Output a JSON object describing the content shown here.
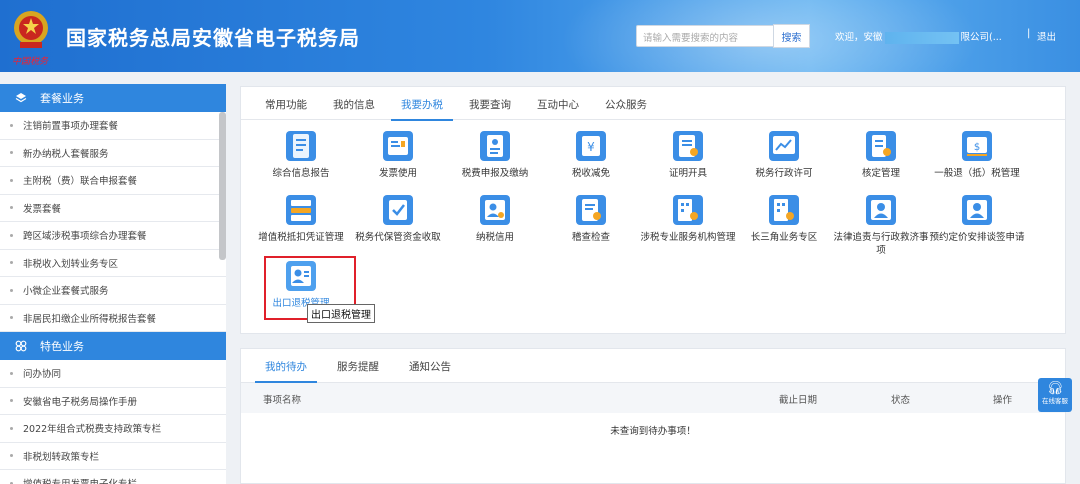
{
  "header": {
    "site_title": "国家税务总局安徽省电子税务局",
    "emblem_text": "中国税务",
    "search_placeholder": "请输入需要搜索的内容",
    "search_button": "搜索",
    "welcome_prefix": "欢迎，安徽",
    "welcome_suffix": "限公司(...",
    "separator": "|",
    "logout": "退出"
  },
  "sidebar": {
    "group1_title": "套餐业务",
    "group1_items": [
      "注销前置事项办理套餐",
      "新办纳税人套餐服务",
      "主附税（费）联合申报套餐",
      "发票套餐",
      "跨区域涉税事项综合办理套餐",
      "非税收入划转业务专区",
      "小微企业套餐式服务",
      "非居民扣缴企业所得税报告套餐"
    ],
    "group2_title": "特色业务",
    "group2_items": [
      "问办协同",
      "安徽省电子税务局操作手册",
      "2022年组合式税费支持政策专栏",
      "非税划转政策专栏",
      "增值税专用发票电子化专栏"
    ]
  },
  "main": {
    "tabs": [
      "常用功能",
      "我的信息",
      "我要办税",
      "我要查询",
      "互动中心",
      "公众服务"
    ],
    "active_tab": "我要办税",
    "tiles": [
      {
        "label": "综合信息报告",
        "icon": "report-icon"
      },
      {
        "label": "发票使用",
        "icon": "invoice-icon"
      },
      {
        "label": "税费申报及缴纳",
        "icon": "tax-declare-icon"
      },
      {
        "label": "税收减免",
        "icon": "tax-reduction-icon"
      },
      {
        "label": "证明开具",
        "icon": "certificate-icon"
      },
      {
        "label": "税务行政许可",
        "icon": "admin-license-icon"
      },
      {
        "label": "核定管理",
        "icon": "assessment-icon"
      },
      {
        "label": "一般退（抵）税管理",
        "icon": "refund-icon"
      },
      {
        "label": "增值税抵扣凭证管理",
        "icon": "vat-deduction-icon"
      },
      {
        "label": "税务代保管资金收取",
        "icon": "custody-fund-icon"
      },
      {
        "label": "纳税信用",
        "icon": "tax-credit-icon"
      },
      {
        "label": "稽查检查",
        "icon": "inspection-icon"
      },
      {
        "label": "涉税专业服务机构管理",
        "icon": "agency-icon"
      },
      {
        "label": "长三角业务专区",
        "icon": "yangtze-delta-icon"
      },
      {
        "label": "法律追责与行政救济事项",
        "icon": "legal-icon"
      },
      {
        "label": "预约定价安排谈签申请",
        "icon": "pricing-icon"
      },
      {
        "label": "出口退税管理",
        "icon": "export-refund-icon"
      }
    ],
    "tooltip": "出口退税管理"
  },
  "todo": {
    "tabs": [
      "我的待办",
      "服务提醒",
      "通知公告"
    ],
    "active_tab": "我的待办",
    "columns": [
      "事项名称",
      "截止日期",
      "状态",
      "操作"
    ],
    "empty_text": "未查询到待办事项！"
  },
  "service": {
    "label": "在线客服",
    "icon": "headset-icon"
  },
  "colors": {
    "primary": "#2f86de",
    "highlight": "#e0202a"
  }
}
